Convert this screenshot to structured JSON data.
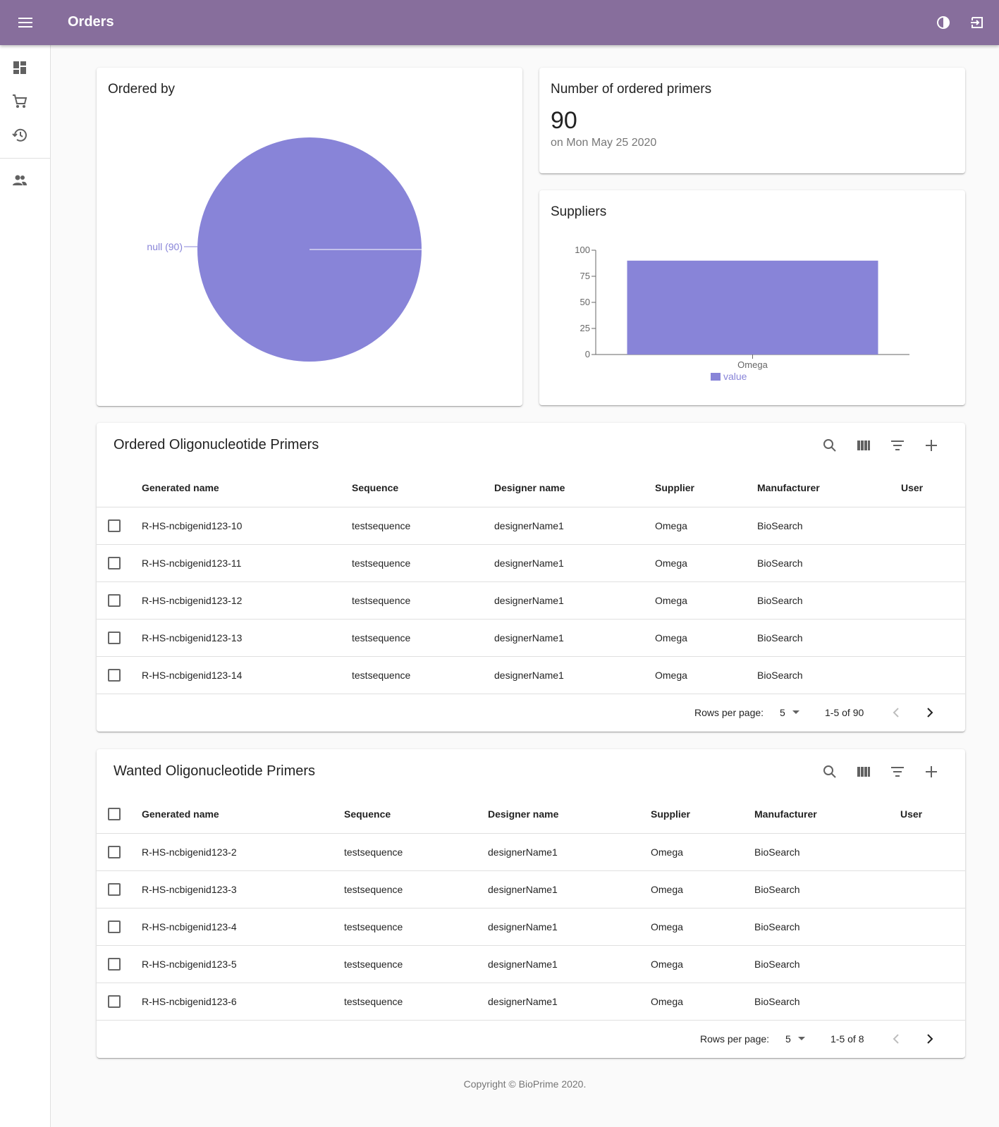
{
  "app": {
    "title": "Orders"
  },
  "icons": {
    "menu": "menu-icon",
    "theme": "contrast-icon",
    "logout": "logout-icon",
    "dashboard": "dashboard-icon",
    "cart": "cart-icon",
    "history": "history-icon",
    "people": "people-icon"
  },
  "colors": {
    "appbar": "#876e9c",
    "chart": "#8884d8"
  },
  "ordered_by": {
    "title": "Ordered by",
    "label": "null (90)"
  },
  "primer_count": {
    "title": "Number of ordered primers",
    "value": "90",
    "date": "on Mon May 25 2020"
  },
  "suppliers": {
    "title": "Suppliers",
    "legend": "value"
  },
  "chart_data": [
    {
      "type": "pie",
      "title": "Ordered by",
      "slices": [
        {
          "label": "null",
          "value": 90
        }
      ]
    },
    {
      "type": "bar",
      "title": "Suppliers",
      "categories": [
        "Omega"
      ],
      "series": [
        {
          "name": "value",
          "values": [
            90
          ]
        }
      ],
      "ylim": [
        0,
        100
      ],
      "yticks": [
        "0",
        "25",
        "50",
        "75",
        "100"
      ],
      "legend": "bottom"
    }
  ],
  "ordered_table": {
    "title": "Ordered Oligonucleotide Primers",
    "columns": [
      "Generated name",
      "Sequence",
      "Designer name",
      "Supplier",
      "Manufacturer",
      "User"
    ],
    "rows": [
      [
        "R-HS-ncbigenid123-10",
        "testsequence",
        "designerName1",
        "Omega",
        "BioSearch",
        ""
      ],
      [
        "R-HS-ncbigenid123-11",
        "testsequence",
        "designerName1",
        "Omega",
        "BioSearch",
        ""
      ],
      [
        "R-HS-ncbigenid123-12",
        "testsequence",
        "designerName1",
        "Omega",
        "BioSearch",
        ""
      ],
      [
        "R-HS-ncbigenid123-13",
        "testsequence",
        "designerName1",
        "Omega",
        "BioSearch",
        ""
      ],
      [
        "R-HS-ncbigenid123-14",
        "testsequence",
        "designerName1",
        "Omega",
        "BioSearch",
        ""
      ]
    ],
    "pager": {
      "rows_label": "Rows per page:",
      "rows_value": "5",
      "range": "1-5 of 90"
    }
  },
  "wanted_table": {
    "title": "Wanted Oligonucleotide Primers",
    "columns": [
      "Generated name",
      "Sequence",
      "Designer name",
      "Supplier",
      "Manufacturer",
      "User"
    ],
    "rows": [
      [
        "R-HS-ncbigenid123-2",
        "testsequence",
        "designerName1",
        "Omega",
        "BioSearch",
        ""
      ],
      [
        "R-HS-ncbigenid123-3",
        "testsequence",
        "designerName1",
        "Omega",
        "BioSearch",
        ""
      ],
      [
        "R-HS-ncbigenid123-4",
        "testsequence",
        "designerName1",
        "Omega",
        "BioSearch",
        ""
      ],
      [
        "R-HS-ncbigenid123-5",
        "testsequence",
        "designerName1",
        "Omega",
        "BioSearch",
        ""
      ],
      [
        "R-HS-ncbigenid123-6",
        "testsequence",
        "designerName1",
        "Omega",
        "BioSearch",
        ""
      ]
    ],
    "pager": {
      "rows_label": "Rows per page:",
      "rows_value": "5",
      "range": "1-5 of 8"
    }
  },
  "footer": {
    "text": "Copyright © BioPrime 2020."
  }
}
